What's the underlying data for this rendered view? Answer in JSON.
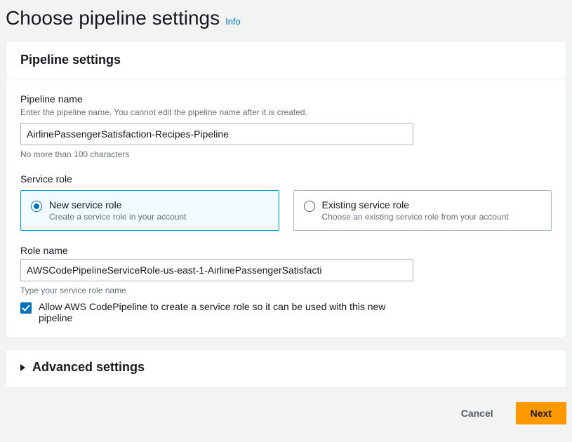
{
  "header": {
    "title": "Choose pipeline settings",
    "info": "Info"
  },
  "panel": {
    "title": "Pipeline settings"
  },
  "pipelineName": {
    "label": "Pipeline name",
    "hint": "Enter the pipeline name. You cannot edit the pipeline name after it is created.",
    "value": "AirlinePassengerSatisfaction-Recipes-Pipeline",
    "constraint": "No more than 100 characters"
  },
  "serviceRole": {
    "label": "Service role",
    "options": [
      {
        "title": "New service role",
        "sub": "Create a service role in your account",
        "selected": true
      },
      {
        "title": "Existing service role",
        "sub": "Choose an existing service role from your account",
        "selected": false
      }
    ]
  },
  "roleName": {
    "label": "Role name",
    "value": "AWSCodePipelineServiceRole-us-east-1-AirlinePassengerSatisfacti",
    "hint": "Type your service role name"
  },
  "allowCheckbox": {
    "checked": true,
    "label": "Allow AWS CodePipeline to create a service role so it can be used with this new pipeline"
  },
  "advanced": {
    "title": "Advanced settings"
  },
  "footer": {
    "cancel": "Cancel",
    "next": "Next"
  }
}
